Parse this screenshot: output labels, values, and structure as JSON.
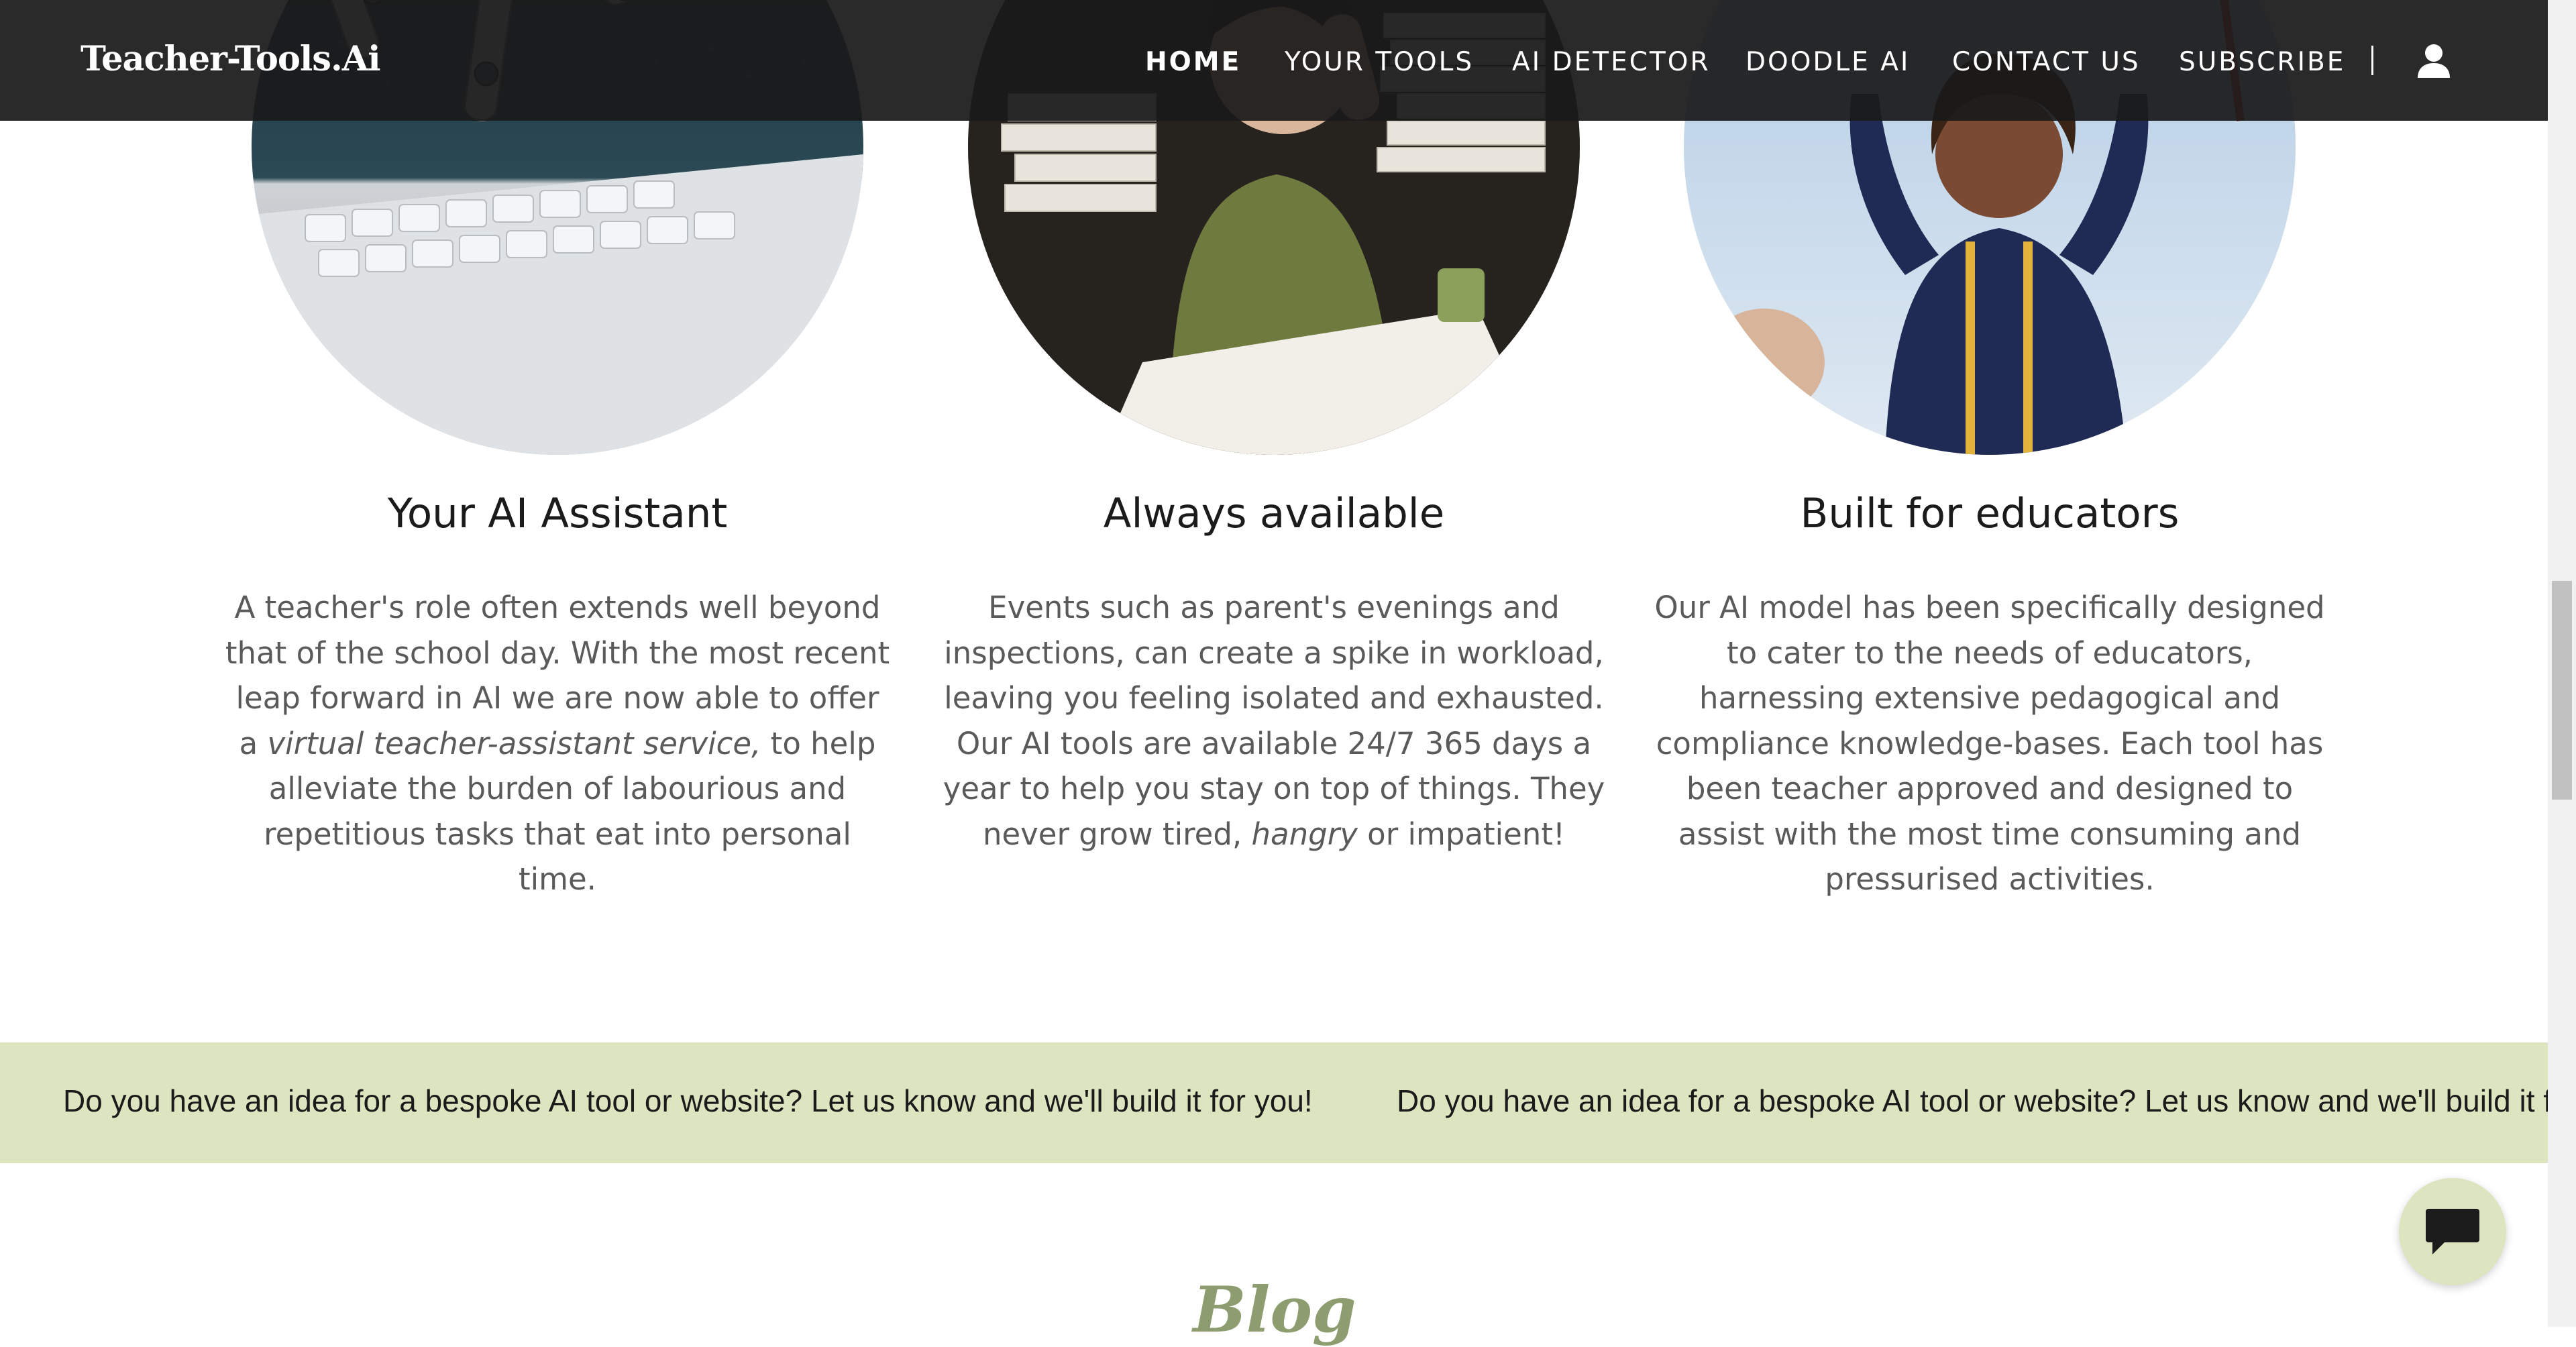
{
  "header": {
    "logo": "Teacher-Tools.Ai",
    "nav": [
      {
        "label": "HOME",
        "active": true
      },
      {
        "label": "YOUR TOOLS"
      },
      {
        "label": "AI DETECTOR"
      },
      {
        "label": "DOODLE AI"
      },
      {
        "label": "CONTACT US"
      },
      {
        "label": "SUBSCRIBE"
      }
    ],
    "account_icon": "user-icon"
  },
  "features": [
    {
      "title": "Your AI Assistant",
      "image": "robot-hand-typing-laptop",
      "text_before": "A teacher's role often extends well beyond that of the school day. With the most recent leap forward in AI we are now able to offer a ",
      "text_emphasis": "virtual teacher-assistant service,",
      "text_after": " to help alleviate the burden of labourious and repetitious tasks that eat into personal time."
    },
    {
      "title": "Always available",
      "image": "stressed-teacher-paperwork",
      "text_before": "Events such as parent's evenings and inspections, can create a spike in workload, leaving you feeling isolated and exhausted. Our AI tools are available 24/7 365 days a year to help you stay on top of things. They never grow tired, ",
      "text_emphasis": "hangry",
      "text_after": " or impatient!"
    },
    {
      "title": "Built for educators",
      "image": "graduation-celebration",
      "text": "Our AI model has been specifically designed to cater to the needs of educators, harnessing extensive pedagogical and compliance knowledge-bases. Each tool has been teacher approved and designed to assist with the most time consuming and pressurised activities."
    }
  ],
  "banner": {
    "text": "Do you have an idea for a bespoke AI tool or website? Let us know and we'll build it for you!"
  },
  "blog": {
    "title": "Blog"
  },
  "chat": {
    "icon": "chat-bubble-icon"
  },
  "colors": {
    "header_bg": "#1a1a1a",
    "banner_bg": "#dce5c0",
    "blog_title": "#8e9d70",
    "body_text": "#5a5a5a"
  }
}
